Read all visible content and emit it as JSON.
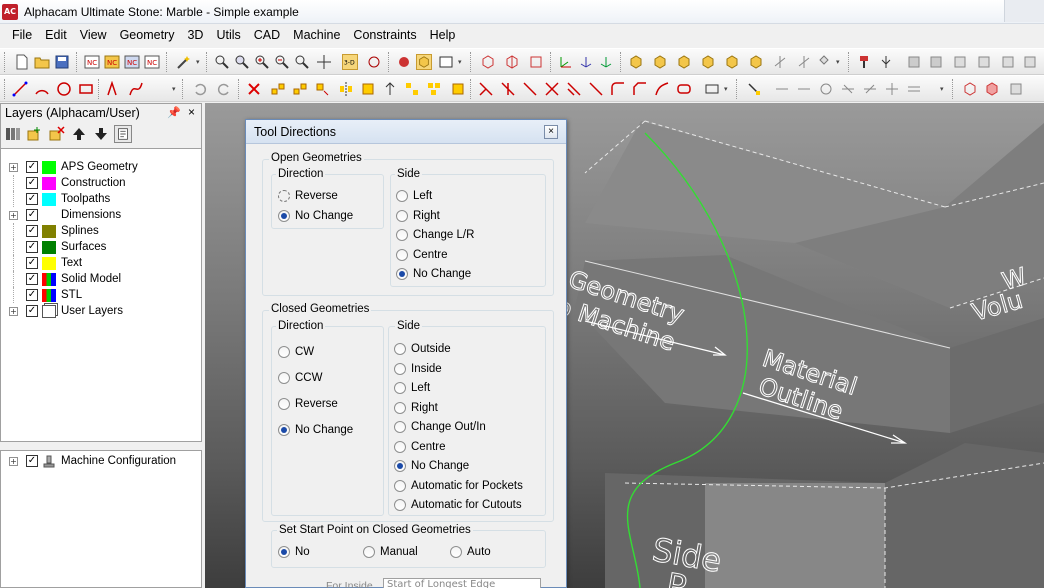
{
  "window": {
    "app_icon_text": "AC",
    "title": "Alphacam Ultimate Stone: Marble - Simple example"
  },
  "menu": [
    "File",
    "Edit",
    "View",
    "Geometry",
    "3D",
    "Utils",
    "CAD",
    "Machine",
    "Constraints",
    "Help"
  ],
  "layers_panel": {
    "title": "Layers (Alphacam/User)",
    "pin_icon": "pin-icon",
    "items": [
      {
        "label": "APS Geometry",
        "color": "#00ff00",
        "expandable": true,
        "checked": true
      },
      {
        "label": "Construction",
        "color": "#ff00ff",
        "expandable": false,
        "checked": true
      },
      {
        "label": "Toolpaths",
        "color": "#00ffff",
        "expandable": false,
        "checked": true
      },
      {
        "label": "Dimensions",
        "color": "#ffffff",
        "expandable": true,
        "checked": true
      },
      {
        "label": "Splines",
        "color": "#808000",
        "expandable": false,
        "checked": true
      },
      {
        "label": "Surfaces",
        "color": "#008000",
        "expandable": false,
        "checked": true
      },
      {
        "label": "Text",
        "color": "#ffff00",
        "expandable": false,
        "checked": true
      },
      {
        "label": "Solid Model",
        "color": "multi",
        "expandable": false,
        "checked": true
      },
      {
        "label": "STL",
        "color": "multi",
        "expandable": false,
        "checked": true
      },
      {
        "label": "User Layers",
        "color": "layers",
        "expandable": true,
        "checked": true
      }
    ]
  },
  "machine_panel": {
    "items": [
      {
        "label": "Machine Configuration",
        "checked": true
      }
    ]
  },
  "viewport": {
    "labels": {
      "geometry": "Geometry",
      "to_machine": "o Machine",
      "material": "Material",
      "outline": "Outline",
      "w1": "W",
      "w2": "Volu",
      "side": "Side",
      "side2": "P"
    },
    "path_color": "#33dd33"
  },
  "dialog": {
    "title": "Tool Directions",
    "open_geometries": {
      "label": "Open Geometries",
      "direction": {
        "label": "Direction",
        "options": [
          {
            "label": "Reverse",
            "selected": false
          },
          {
            "label": "No Change",
            "selected": true
          }
        ]
      },
      "side": {
        "label": "Side",
        "options": [
          {
            "label": "Left",
            "selected": false
          },
          {
            "label": "Right",
            "selected": false
          },
          {
            "label": "Change L/R",
            "selected": false
          },
          {
            "label": "Centre",
            "selected": false
          },
          {
            "label": "No Change",
            "selected": true
          }
        ]
      }
    },
    "closed_geometries": {
      "label": "Closed Geometries",
      "direction": {
        "label": "Direction",
        "options": [
          {
            "label": "CW",
            "selected": false
          },
          {
            "label": "CCW",
            "selected": false
          },
          {
            "label": "Reverse",
            "selected": false
          },
          {
            "label": "No Change",
            "selected": true
          }
        ]
      },
      "side": {
        "label": "Side",
        "options": [
          {
            "label": "Outside",
            "selected": false
          },
          {
            "label": "Inside",
            "selected": false
          },
          {
            "label": "Left",
            "selected": false
          },
          {
            "label": "Right",
            "selected": false
          },
          {
            "label": "Change Out/In",
            "selected": false
          },
          {
            "label": "Centre",
            "selected": false
          },
          {
            "label": "No Change",
            "selected": true
          },
          {
            "label": "Automatic for Pockets",
            "selected": false
          },
          {
            "label": "Automatic for Cutouts",
            "selected": false
          }
        ]
      }
    },
    "start_point": {
      "label": "Set Start Point on Closed Geometries",
      "options": [
        {
          "label": "No",
          "selected": true
        },
        {
          "label": "Manual",
          "selected": false
        },
        {
          "label": "Auto",
          "selected": false
        }
      ]
    },
    "for_inside": {
      "label": "For Inside",
      "value": "Start of Longest Edge"
    }
  }
}
